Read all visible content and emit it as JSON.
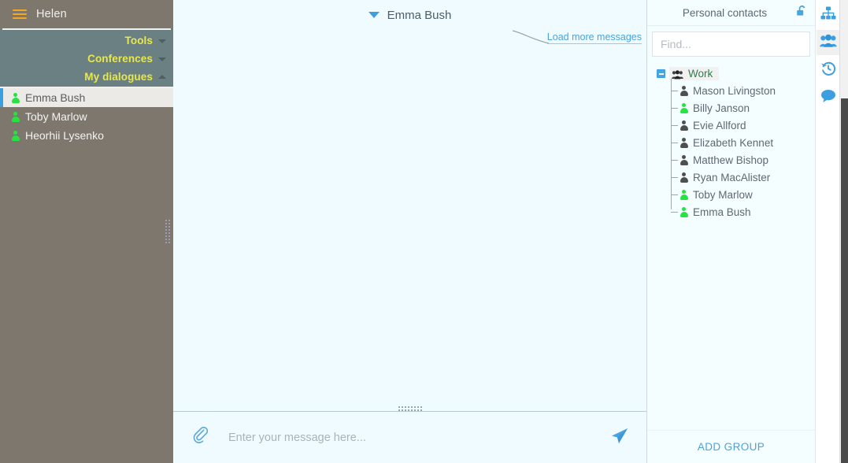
{
  "sidebar": {
    "menu_icon": "hamburger-icon",
    "user_name": "Helen",
    "menu_items": [
      {
        "label": "Tools",
        "caret": "chevron-down-icon"
      },
      {
        "label": "Conferences",
        "caret": "chevron-down-icon"
      },
      {
        "label": "My dialogues",
        "caret": "chevron-up-icon"
      }
    ],
    "dialogues": [
      {
        "name": "Emma Bush",
        "status": "offline",
        "selected": true
      },
      {
        "name": "Toby Marlow",
        "status": "online",
        "selected": false
      },
      {
        "name": "Heorhii Lysenko",
        "status": "online",
        "selected": false
      }
    ]
  },
  "chat": {
    "collapse_icon": "chevron-down-icon",
    "title": "Emma Bush",
    "load_more_label": "Load more messages",
    "composer": {
      "attach_icon": "paperclip-icon",
      "placeholder": "Enter your message here...",
      "value": "",
      "send_icon": "send-paper-plane-icon"
    }
  },
  "right_panel": {
    "title": "Personal contacts",
    "lock_icon": "unlock-icon",
    "search": {
      "placeholder": "Find...",
      "value": ""
    },
    "tree": {
      "group": {
        "label": "Work",
        "toggle": "collapse-minus-icon",
        "icon": "group-people-icon"
      },
      "contacts": [
        {
          "name": "Mason Livingston",
          "status": "offline"
        },
        {
          "name": "Billy Janson",
          "status": "online"
        },
        {
          "name": "Evie Allford",
          "status": "offline"
        },
        {
          "name": "Elizabeth Kennet",
          "status": "offline"
        },
        {
          "name": "Matthew Bishop",
          "status": "offline"
        },
        {
          "name": "Ryan MacAlister",
          "status": "offline"
        },
        {
          "name": "Toby Marlow",
          "status": "online"
        },
        {
          "name": "Emma Bush",
          "status": "online"
        }
      ]
    },
    "add_group_label": "ADD GROUP"
  },
  "rail": {
    "items": [
      {
        "icon": "sitemap-org-chart-icon",
        "active": false
      },
      {
        "icon": "contacts-group-icon",
        "active": true
      },
      {
        "icon": "history-clock-icon",
        "active": false
      },
      {
        "icon": "chat-bubble-icon",
        "active": false
      }
    ]
  },
  "colors": {
    "sidebar_bg": "#7d776d",
    "menu_bg": "#6b8082",
    "menu_text": "#e8e84a",
    "accent_blue": "#3e9fe0",
    "link_blue": "#4aa3df",
    "chat_bg": "#effbff",
    "online_green": "#26e341",
    "offline_gray": "#4a4a4a",
    "brand_orange": "#f5a623"
  }
}
